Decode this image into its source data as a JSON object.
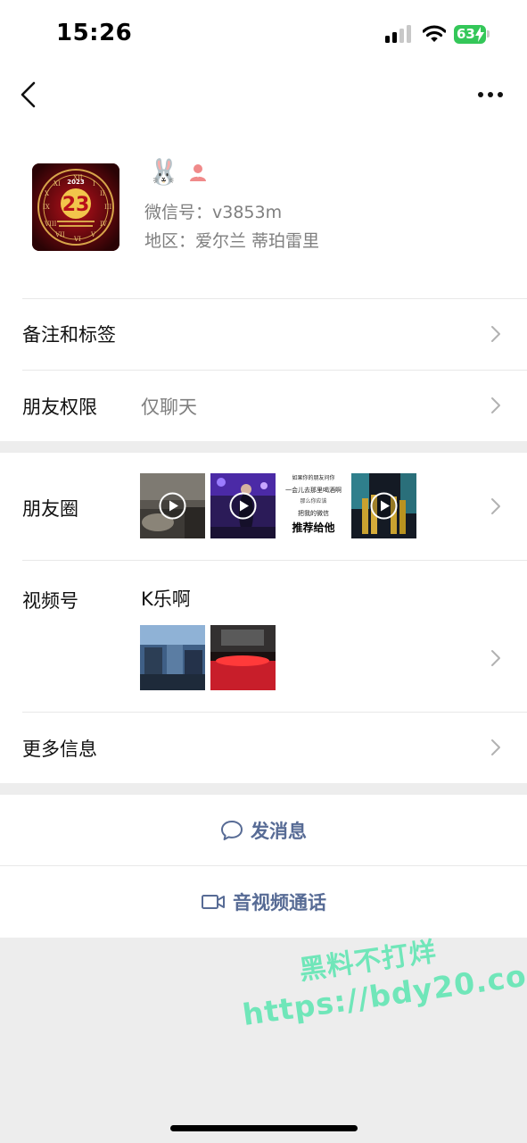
{
  "status_bar": {
    "time": "15:26",
    "battery": "63",
    "signal_bars_active": 2,
    "signal_bars_total": 4,
    "battery_color": "#34c759"
  },
  "nav": {
    "back_icon": "chevron-left-icon",
    "more_icon": "more-dots-icon"
  },
  "profile": {
    "nickname_emoji": "🐰",
    "gender_icon": "female-person-icon",
    "wechat_id": "微信号：v3853m",
    "region": "地区：爱尔兰 蒂珀雷里",
    "avatar_text": "23",
    "avatar_year": "2023"
  },
  "rows": {
    "remark": {
      "label": "备注和标签"
    },
    "permission": {
      "label": "朋友权限",
      "value": "仅聊天"
    },
    "moments": {
      "label": "朋友圈",
      "thumb3_lines": [
        "如果你的朋友问你",
        "一会儿去那里喝酒啊",
        "那么你应该",
        "把我的微信",
        "推荐给他"
      ]
    },
    "channels": {
      "label": "视频号",
      "value": "K乐啊"
    },
    "more_info": {
      "label": "更多信息"
    }
  },
  "actions": {
    "message": {
      "label": "发消息",
      "icon": "chat-bubble-icon"
    },
    "call": {
      "label": "音视频通话",
      "icon": "video-camera-icon"
    }
  },
  "watermark": {
    "line1": "黑料不打烊",
    "line2": "https://bdy20.co"
  },
  "colors": {
    "link_blue": "#576b95",
    "secondary_text": "#7f7f7f",
    "background": "#ededed",
    "watermark": "#63e6b4"
  }
}
